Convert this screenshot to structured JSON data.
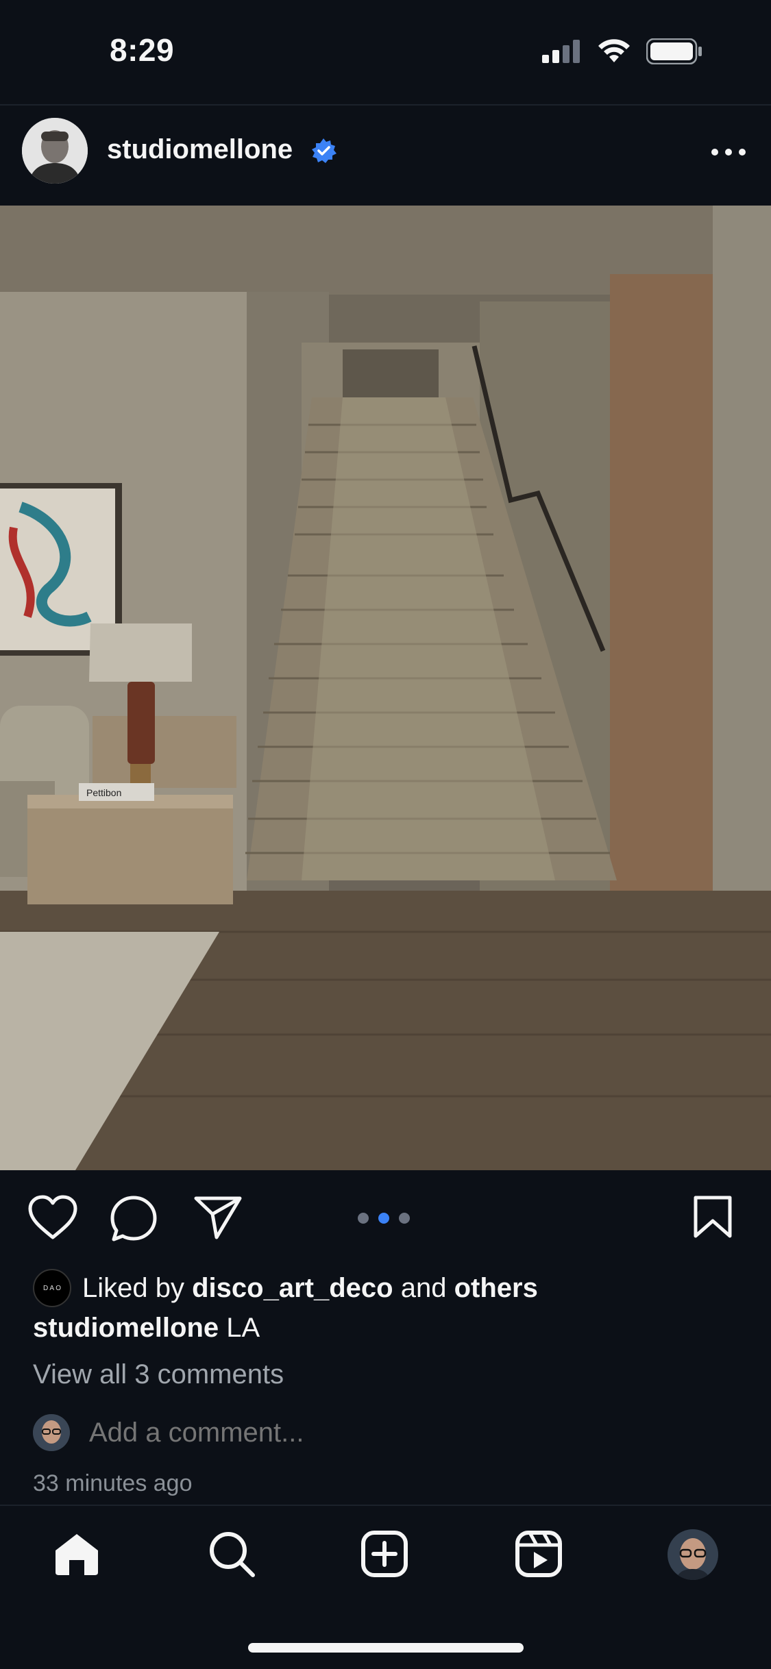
{
  "status": {
    "time": "8:29",
    "icons": [
      "cellular-signal-icon",
      "wifi-icon",
      "battery-icon"
    ]
  },
  "post": {
    "username": "studiomellone",
    "verified": true,
    "image_description_icon": "photo",
    "carousel": {
      "count": 3,
      "active_index": 1
    }
  },
  "likes": {
    "prefix": "Liked by",
    "user": "disco_art_deco",
    "connector": "and",
    "suffix": "others",
    "avatar_text": "D A O"
  },
  "caption": {
    "username": "studiomellone",
    "text": "LA"
  },
  "comments": {
    "view_all": "View all 3 comments",
    "placeholder": "Add a comment..."
  },
  "timestamp": "33 minutes ago",
  "tabs": [
    "home-icon",
    "search-icon",
    "create-icon",
    "reels-icon",
    "profile-avatar"
  ],
  "colors": {
    "accent": "#3b82f6",
    "background": "#0c1017",
    "muted": "#8a9097"
  }
}
